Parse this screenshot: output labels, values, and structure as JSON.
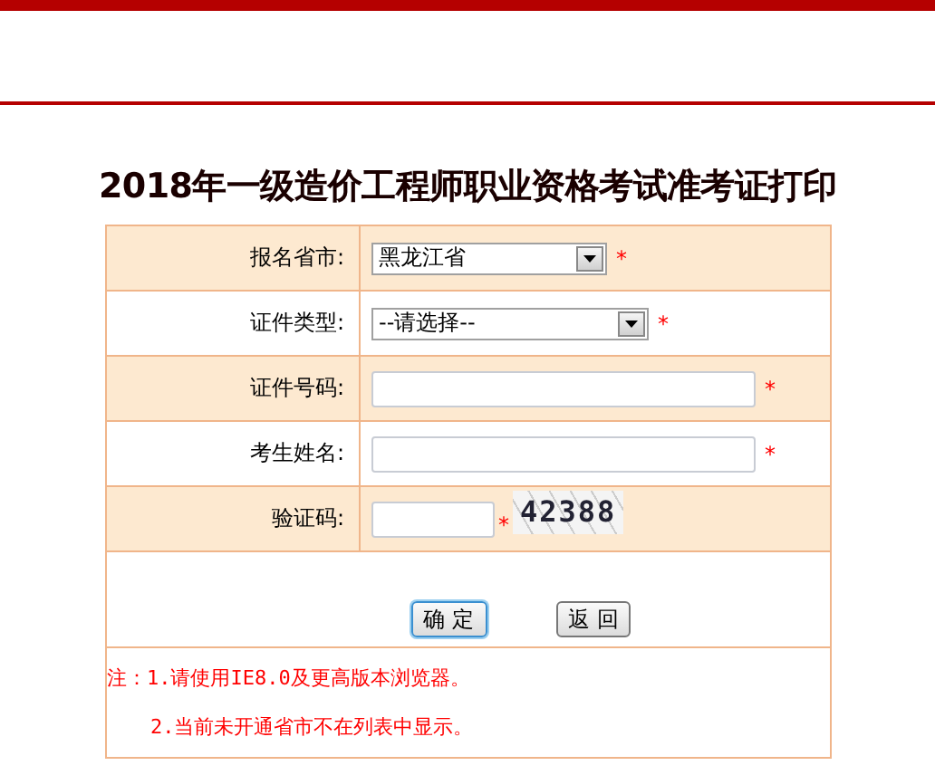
{
  "title": "2018年一级造价工程师职业资格考试准考证打印",
  "rows": [
    {
      "label": "报名省市:",
      "kind": "select",
      "value": "黑龙江省",
      "mark": "*"
    },
    {
      "label": "证件类型:",
      "kind": "select",
      "value": "--请选择--",
      "mark": "*"
    },
    {
      "label": "证件号码:",
      "kind": "input",
      "mark": "*"
    },
    {
      "label": "考生姓名:",
      "kind": "input",
      "mark": "*"
    },
    {
      "label": "验证码:",
      "kind": "captcha",
      "mark": "*",
      "captcha": "42388"
    }
  ],
  "buttons": [
    {
      "label": "确 定",
      "selected": true
    },
    {
      "label": "返 回",
      "selected": false
    }
  ],
  "notes": [
    "注：1.请使用IE8.0及更高版本浏览器。",
    "2.当前未开通省市不在列表中显示。"
  ]
}
